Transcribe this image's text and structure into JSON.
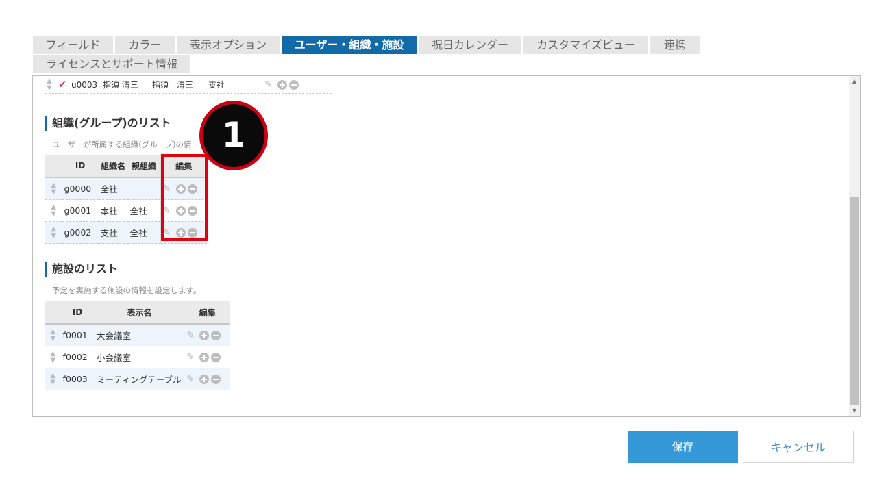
{
  "tabs": {
    "row1": [
      {
        "label": "フィールド",
        "active": false
      },
      {
        "label": "カラー",
        "active": false
      },
      {
        "label": "表示オプション",
        "active": false
      },
      {
        "label": "ユーザー・組織・施設",
        "active": true
      },
      {
        "label": "祝日カレンダー",
        "active": false
      },
      {
        "label": "カスタマイズビュー",
        "active": false
      },
      {
        "label": "連携",
        "active": false
      }
    ],
    "row2": [
      {
        "label": "ライセンスとサポート情報",
        "active": false
      }
    ]
  },
  "user_row": {
    "id": "u0003",
    "name": "指須 清三",
    "display": "指須　清三",
    "org": "支社"
  },
  "org_section": {
    "title": "組織(グループ)のリスト",
    "description": "ユーザーが所属する組織(グループ)の情",
    "headers": {
      "id": "ID",
      "name": "組織名",
      "parent": "親組織",
      "edit": "編集"
    },
    "rows": [
      {
        "id": "g0000",
        "name": "全社",
        "parent": ""
      },
      {
        "id": "g0001",
        "name": "本社",
        "parent": "全社"
      },
      {
        "id": "g0002",
        "name": "支社",
        "parent": "全社"
      }
    ]
  },
  "facility_section": {
    "title": "施設のリスト",
    "description": "予定を実施する施設の情報を設定します。",
    "headers": {
      "id": "ID",
      "name": "表示名",
      "edit": "編集"
    },
    "rows": [
      {
        "id": "f0001",
        "name": "大会議室"
      },
      {
        "id": "f0002",
        "name": "小会議室"
      },
      {
        "id": "f0003",
        "name": "ミーティングテーブル"
      }
    ]
  },
  "callout": {
    "number": "1"
  },
  "buttons": {
    "save": "保存",
    "cancel": "キャンセル"
  },
  "colors": {
    "accent": "#136aa8",
    "save_button": "#3699d7",
    "highlight": "#e0000e"
  },
  "icons": [
    "sort-icon",
    "check-icon",
    "edit-icon",
    "plus-circle-icon",
    "minus-circle-icon"
  ]
}
